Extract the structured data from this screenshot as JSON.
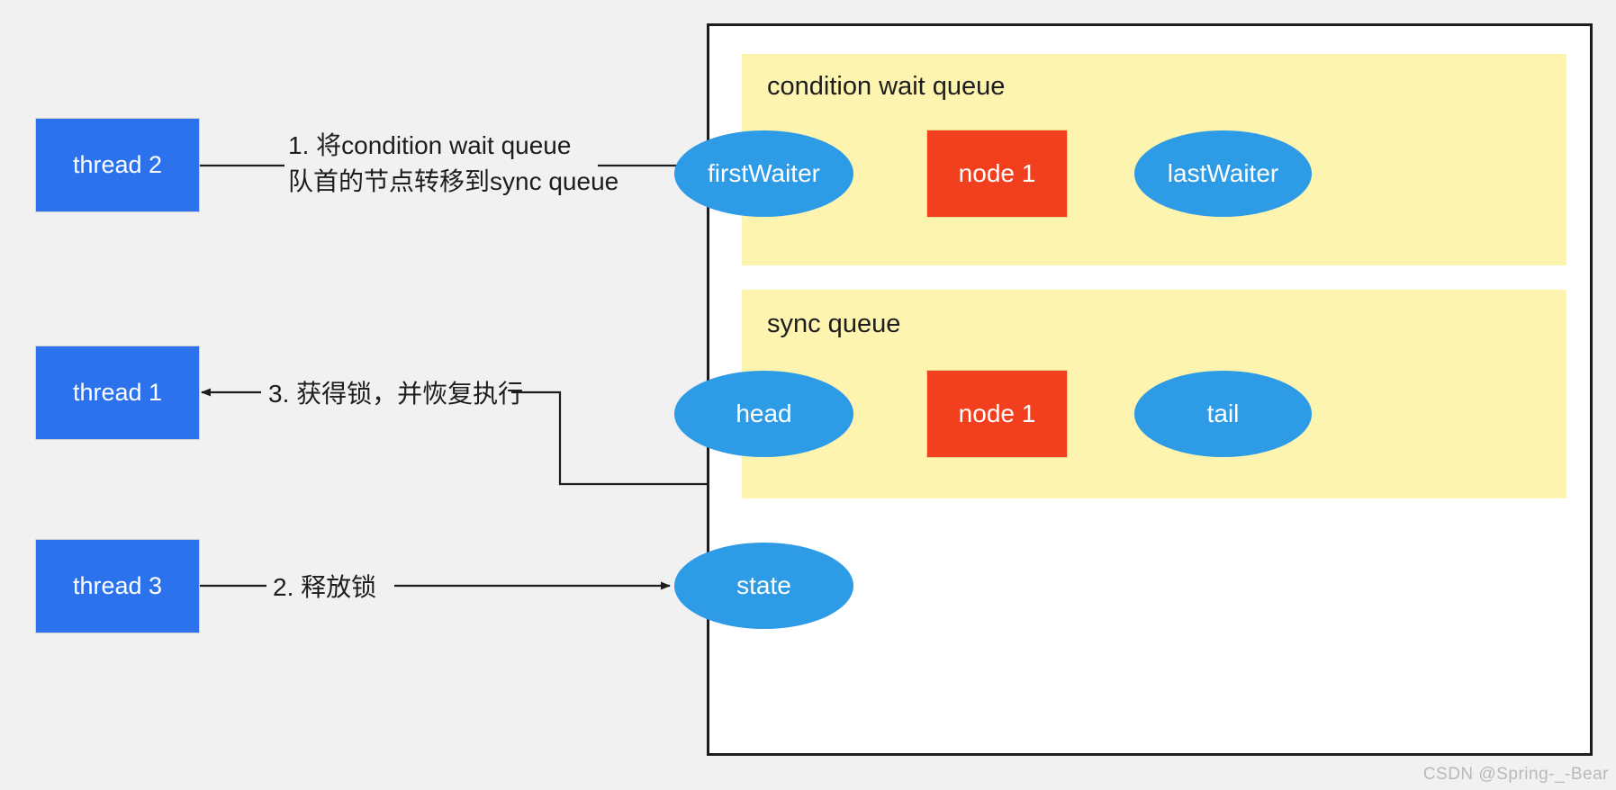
{
  "diagram": {
    "title": "AQS condition wait queue to sync queue transfer",
    "watermark": "CSDN @Spring-_-Bear",
    "colors": {
      "background": "#f1f1f1",
      "thread_box": "#2B72EC",
      "ellipse_node": "#2D9BE6",
      "rect_node": "#F2401F",
      "queue_band": "#FDF4AF",
      "container_border": "#1d1d1d",
      "container_fill": "#ffffff",
      "text_light": "#ffffff",
      "text_dark": "#1d1d1d",
      "watermark": "#b9b9b9"
    }
  },
  "threads": [
    {
      "id": "thread2",
      "label": "thread 2"
    },
    {
      "id": "thread1",
      "label": "thread 1"
    },
    {
      "id": "thread3",
      "label": "thread 3"
    }
  ],
  "labels": {
    "step1_line1": "1. 将condition wait queue",
    "step1_line2": "队首的节点转移到sync queue",
    "step3": "3. 获得锁，并恢复执行",
    "step2": "2. 释放锁"
  },
  "condition_queue": {
    "title": "condition wait queue",
    "nodes": [
      {
        "id": "firstWaiter",
        "label": "firstWaiter",
        "shape": "ellipse"
      },
      {
        "id": "cond-node-1",
        "label": "node 1",
        "shape": "rect"
      },
      {
        "id": "lastWaiter",
        "label": "lastWaiter",
        "shape": "ellipse"
      }
    ],
    "edge_style": "dashed"
  },
  "sync_queue": {
    "title": "sync queue",
    "nodes": [
      {
        "id": "head",
        "label": "head",
        "shape": "ellipse"
      },
      {
        "id": "sync-node-1",
        "label": "node 1",
        "shape": "rect"
      },
      {
        "id": "tail",
        "label": "tail",
        "shape": "ellipse"
      }
    ],
    "edge_style": "solid"
  },
  "state_node": {
    "id": "state",
    "label": "state",
    "shape": "ellipse"
  }
}
